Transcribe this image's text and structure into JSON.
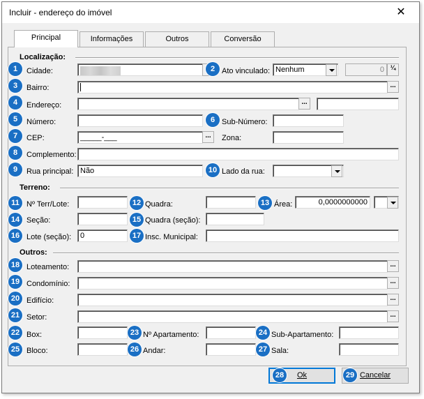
{
  "window": {
    "title": "Incluir - endereço do imóvel",
    "close_glyph": "✕"
  },
  "tabs": [
    {
      "label": "Principal"
    },
    {
      "label": "Informações"
    },
    {
      "label": "Outros"
    },
    {
      "label": "Conversão"
    }
  ],
  "badges": [
    "1",
    "2",
    "3",
    "4",
    "5",
    "6",
    "7",
    "8",
    "9",
    "10",
    "11",
    "12",
    "13",
    "14",
    "15",
    "16",
    "17",
    "18",
    "19",
    "20",
    "21",
    "22",
    "23",
    "24",
    "25",
    "26",
    "27",
    "28",
    "29"
  ],
  "sections": {
    "localizacao": "Localização:",
    "terreno": "Terreno:",
    "outros": "Outros:"
  },
  "labels": {
    "cidade": "Cidade:",
    "ato_vinculado": "Ato vinculado:",
    "bairro": "Bairro:",
    "endereco": "Endereço:",
    "numero": "Número:",
    "sub_numero": "Sub-Número:",
    "cep": "CEP:",
    "zona": "Zona:",
    "complemento": "Complemento:",
    "rua_principal": "Rua principal:",
    "lado_rua": "Lado da rua:",
    "nro_terr": "Nº Terr/Lote:",
    "quadra": "Quadra:",
    "area": "Área:",
    "secao": "Seção:",
    "quadra_secao": "Quadra (seção):",
    "lote_secao": "Lote (seção):",
    "insc_municipal": "Insc. Municipal:",
    "loteamento": "Loteamento:",
    "condominio": "Condomínio:",
    "edificio": "Edifício:",
    "setor": "Setor:",
    "box": "Box:",
    "nro_apartamento": "Nº Apartamento:",
    "sub_apartamento": "Sub-Apartamento:",
    "bloco": "Bloco:",
    "andar": "Andar:",
    "sala": "Sala:"
  },
  "values": {
    "ato_vinculado": "Nenhum",
    "ato_numero": "0",
    "cep": "_____-___",
    "rua_principal": "Não",
    "area": "0,0000000000",
    "lote_secao": "0"
  },
  "buttons": {
    "ellipsis": "...",
    "ok": "Ok",
    "cancelar": "Cancelar"
  },
  "colors": {
    "badge": "#1a6fc4",
    "default_border": "#0078d7"
  }
}
